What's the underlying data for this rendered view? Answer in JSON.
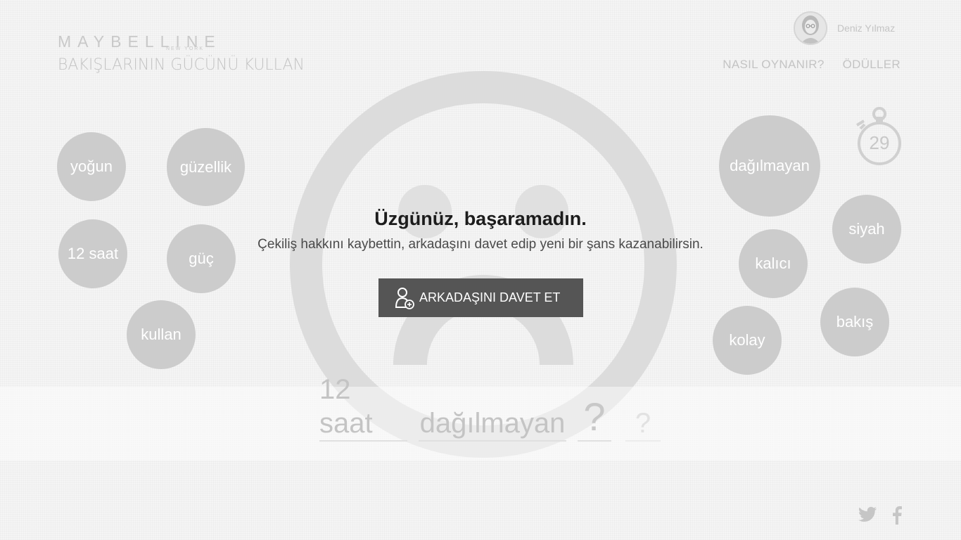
{
  "brand": {
    "name": "MAYBELLINE",
    "sub": "NEW YORK",
    "tagline": "BAKIŞLARININ GÜCÜNÜ KULLAN"
  },
  "user": {
    "name": "Deniz Yılmaz",
    "avatar_icon": "user-avatar"
  },
  "nav": {
    "how_to_play": "NASIL OYNANIR?",
    "rewards": "ÖDÜLLER"
  },
  "timer": {
    "seconds": "29",
    "icon": "stopwatch-icon"
  },
  "words_left": [
    "yoğun",
    "güzellik",
    "12 saat",
    "güç",
    "kullan"
  ],
  "words_right": [
    "dağılmayan",
    "siyah",
    "kalıcı",
    "bakış",
    "kolay"
  ],
  "answer_slots": [
    "12 saat",
    "dağılmayan",
    "?",
    "?"
  ],
  "modal": {
    "title": "Üzgünüz, başaramadın.",
    "text": "Çekiliş hakkını kaybettin, arkadaşını davet edip yeni bir şans kazanabilirsin.",
    "button": "ARKADAŞINI DAVET ET",
    "button_icon": "add-user-icon"
  },
  "social": {
    "twitter_icon": "twitter-icon",
    "facebook_icon": "facebook-icon"
  },
  "colors": {
    "bubble": "#cccccc",
    "button_bg": "#555555",
    "face": "#dcdcdc"
  }
}
